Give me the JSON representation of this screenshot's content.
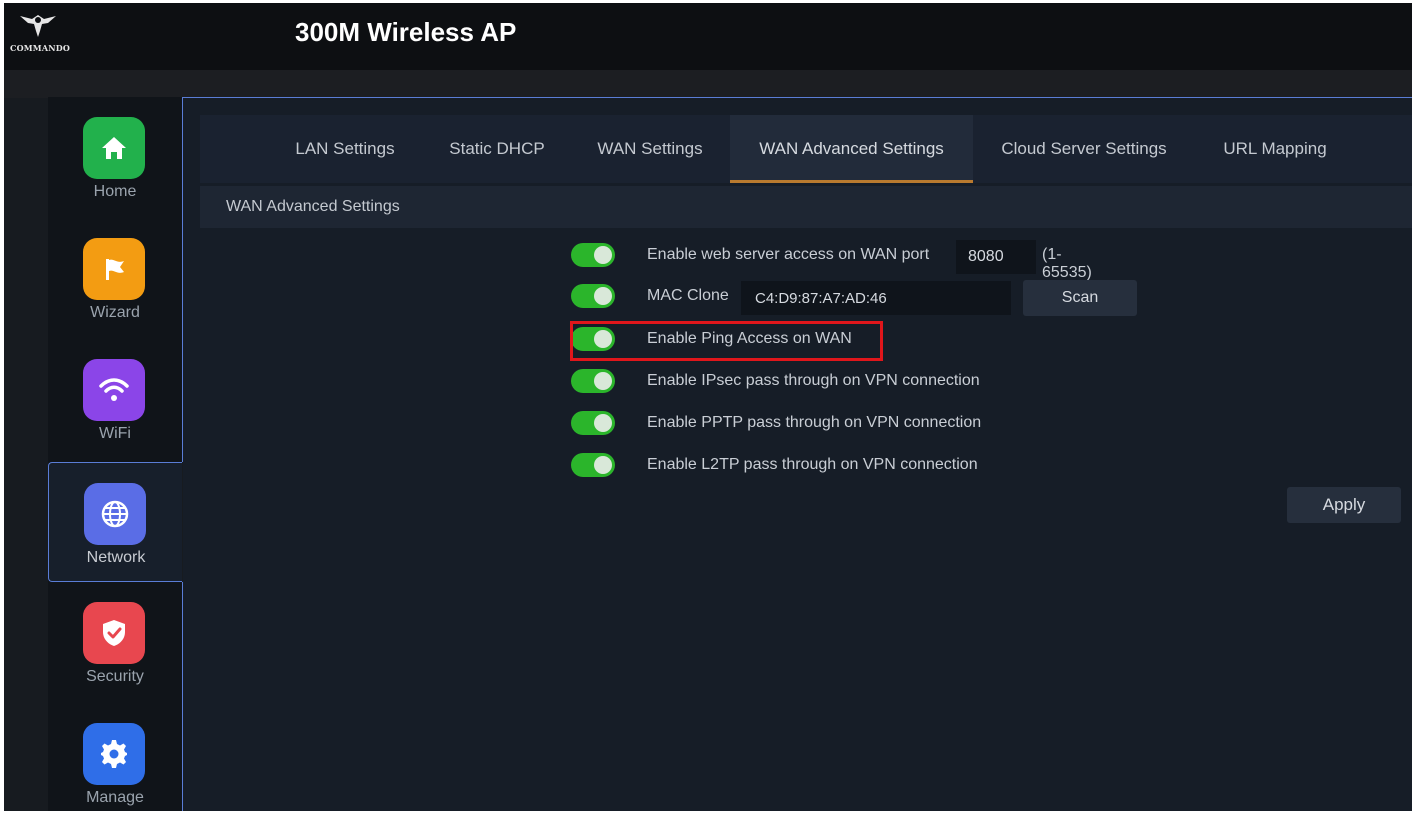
{
  "header": {
    "brand_text": "COMMANDO",
    "app_title": "300M Wireless AP"
  },
  "sidebar": {
    "items": [
      {
        "label": "Home",
        "icon": "home-icon",
        "color": "#22b14c",
        "active": false
      },
      {
        "label": "Wizard",
        "icon": "flag-icon",
        "color": "#f39c12",
        "active": false
      },
      {
        "label": "WiFi",
        "icon": "wifi-icon",
        "color": "#8b45e8",
        "active": false
      },
      {
        "label": "Network",
        "icon": "globe-icon",
        "color": "#5a6de6",
        "active": true
      },
      {
        "label": "Security",
        "icon": "shield-icon",
        "color": "#e8474f",
        "active": false
      },
      {
        "label": "Manage",
        "icon": "gear-icon",
        "color": "#2f6ee8",
        "active": false
      }
    ]
  },
  "tabs": [
    {
      "label": "LAN Settings",
      "active": false
    },
    {
      "label": "Static DHCP",
      "active": false
    },
    {
      "label": "WAN Settings",
      "active": false
    },
    {
      "label": "WAN Advanced Settings",
      "active": true
    },
    {
      "label": "Cloud Server Settings",
      "active": false
    },
    {
      "label": "URL Mapping",
      "active": false
    }
  ],
  "section": {
    "title": "WAN Advanced Settings"
  },
  "settings": {
    "web_access": {
      "label": "Enable web server access on WAN port",
      "port": "8080",
      "range": "(1-65535)",
      "enabled": true
    },
    "mac_clone": {
      "label": "MAC Clone",
      "mac": "C4:D9:87:A7:AD:46",
      "scan_label": "Scan",
      "enabled": true
    },
    "ping_access": {
      "label": "Enable Ping Access on WAN",
      "enabled": true,
      "highlighted": true
    },
    "ipsec": {
      "label": "Enable IPsec pass through on VPN connection",
      "enabled": true
    },
    "pptp": {
      "label": "Enable PPTP pass through on VPN connection",
      "enabled": true
    },
    "l2tp": {
      "label": "Enable L2TP pass through on VPN connection",
      "enabled": true
    }
  },
  "actions": {
    "apply_label": "Apply"
  },
  "colors": {
    "toggle_on": "#2bb52b",
    "active_tab_underline": "#b97a2f",
    "highlight": "#e0161b",
    "accent_border": "#5a7dd6"
  }
}
